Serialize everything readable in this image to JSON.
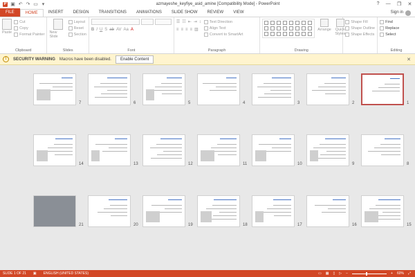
{
  "window": {
    "title": "azmayeshe_keyfiye_asid_amine [Compatibility Mode] - PowerPoint",
    "app_icon": "P",
    "controls": [
      "?",
      "—",
      "❐",
      "✕"
    ]
  },
  "tabs": [
    "FILE",
    "HOME",
    "INSERT",
    "DESIGN",
    "TRANSITIONS",
    "ANIMATIONS",
    "SLIDE SHOW",
    "REVIEW",
    "VIEW"
  ],
  "active_tab": "HOME",
  "signin": "Sign in",
  "ribbon": {
    "clipboard": {
      "label": "Clipboard",
      "paste": "Paste",
      "cut": "Cut",
      "copy": "Copy",
      "format_painter": "Format Painter"
    },
    "slides": {
      "label": "Slides",
      "new_slide": "New Slide",
      "layout": "Layout",
      "reset": "Reset",
      "section": "Section"
    },
    "font": {
      "label": "Font"
    },
    "paragraph": {
      "label": "Paragraph",
      "text_direction": "Text Direction",
      "align_text": "Align Text",
      "convert": "Convert to SmartArt"
    },
    "drawing": {
      "label": "Drawing",
      "arrange": "Arrange",
      "quick_styles": "Quick Styles",
      "shape_fill": "Shape Fill",
      "shape_outline": "Shape Outline",
      "shape_effects": "Shape Effects"
    },
    "editing": {
      "label": "Editing",
      "find": "Find",
      "replace": "Replace",
      "select": "Select"
    }
  },
  "security": {
    "title": "SECURITY WARNING",
    "message": "Macros have been disabled.",
    "button": "Enable Content"
  },
  "slides": [
    {
      "n": "1"
    },
    {
      "n": "2"
    },
    {
      "n": "3"
    },
    {
      "n": "4"
    },
    {
      "n": "5"
    },
    {
      "n": "6"
    },
    {
      "n": "7"
    },
    {
      "n": "8"
    },
    {
      "n": "9"
    },
    {
      "n": "10"
    },
    {
      "n": "11"
    },
    {
      "n": "12"
    },
    {
      "n": "13"
    },
    {
      "n": "14"
    },
    {
      "n": "15"
    },
    {
      "n": "16"
    },
    {
      "n": "17"
    },
    {
      "n": "18"
    },
    {
      "n": "19"
    },
    {
      "n": "20"
    },
    {
      "n": "21"
    }
  ],
  "status": {
    "slide_count": "SLIDE 1 OF 21",
    "language": "ENGLISH (UNITED STATES)",
    "zoom": "60%"
  },
  "colors": {
    "accent": "#d24726",
    "warning_bg": "#fff4ce",
    "selected_border": "#c0504d"
  }
}
